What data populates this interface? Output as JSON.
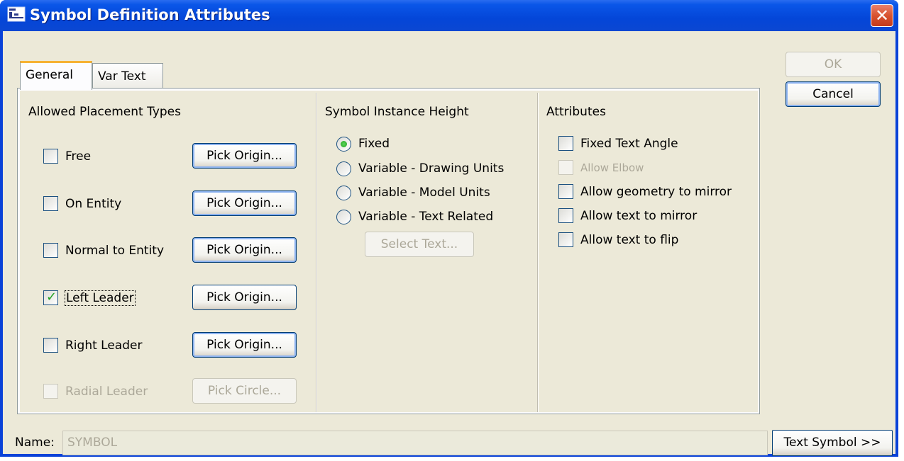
{
  "window": {
    "title": "Symbol Definition Attributes"
  },
  "tabs": [
    {
      "label": "General",
      "active": true
    },
    {
      "label": "Var Text",
      "active": false
    }
  ],
  "placement": {
    "heading": "Allowed Placement Types",
    "items": [
      {
        "label": "Free",
        "checked": false,
        "enabled": true,
        "button": "Pick Origin..."
      },
      {
        "label": "On Entity",
        "checked": false,
        "enabled": true,
        "button": "Pick Origin..."
      },
      {
        "label": "Normal to Entity",
        "checked": false,
        "enabled": true,
        "button": "Pick Origin..."
      },
      {
        "label": "Left Leader",
        "checked": true,
        "enabled": true,
        "button": "Pick Origin..."
      },
      {
        "label": "Right Leader",
        "checked": false,
        "enabled": true,
        "button": "Pick Origin..."
      },
      {
        "label": "Radial Leader",
        "checked": false,
        "enabled": false,
        "button": "Pick Circle..."
      }
    ]
  },
  "height": {
    "heading": "Symbol Instance Height",
    "options": [
      {
        "label": "Fixed",
        "selected": true
      },
      {
        "label": "Variable - Drawing Units",
        "selected": false
      },
      {
        "label": "Variable - Model Units",
        "selected": false
      },
      {
        "label": "Variable - Text Related",
        "selected": false
      }
    ],
    "select_text_button": "Select Text..."
  },
  "attributes": {
    "heading": "Attributes",
    "items": [
      {
        "label": "Fixed Text Angle",
        "checked": false,
        "enabled": true
      },
      {
        "label": "Allow Elbow",
        "checked": false,
        "enabled": false
      },
      {
        "label": "Allow geometry to mirror",
        "checked": false,
        "enabled": true
      },
      {
        "label": "Allow text to mirror",
        "checked": false,
        "enabled": true
      },
      {
        "label": "Allow text to flip",
        "checked": false,
        "enabled": true
      }
    ]
  },
  "buttons": {
    "ok": "OK",
    "cancel": "Cancel",
    "text_symbol": "Text Symbol >>"
  },
  "name": {
    "label": "Name:",
    "value": "SYMBOL"
  },
  "colors": {
    "title_bar": "#0446d8",
    "dialog_bg": "#ece9d8",
    "accent_tab": "#f6b234",
    "check_green": "#21a121"
  }
}
